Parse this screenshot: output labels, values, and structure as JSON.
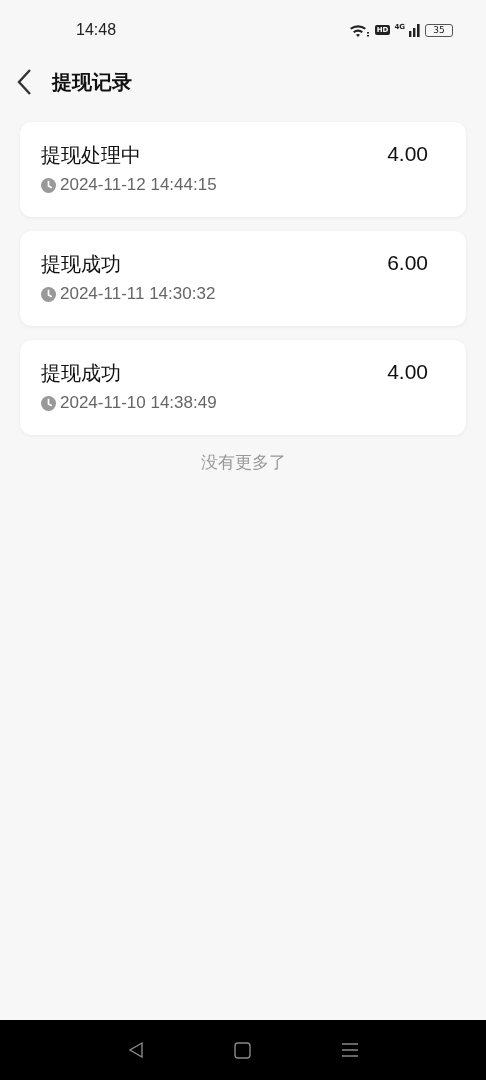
{
  "status_bar": {
    "time": "14:48",
    "hd": "HD",
    "network": "4G",
    "battery": "35"
  },
  "header": {
    "title": "提现记录"
  },
  "records": [
    {
      "status": "提现处理中",
      "amount": "4.00",
      "time": "2024-11-12 14:44:15"
    },
    {
      "status": "提现成功",
      "amount": "6.00",
      "time": "2024-11-11 14:30:32"
    },
    {
      "status": "提现成功",
      "amount": "4.00",
      "time": "2024-11-10 14:38:49"
    }
  ],
  "footer_note": "没有更多了"
}
